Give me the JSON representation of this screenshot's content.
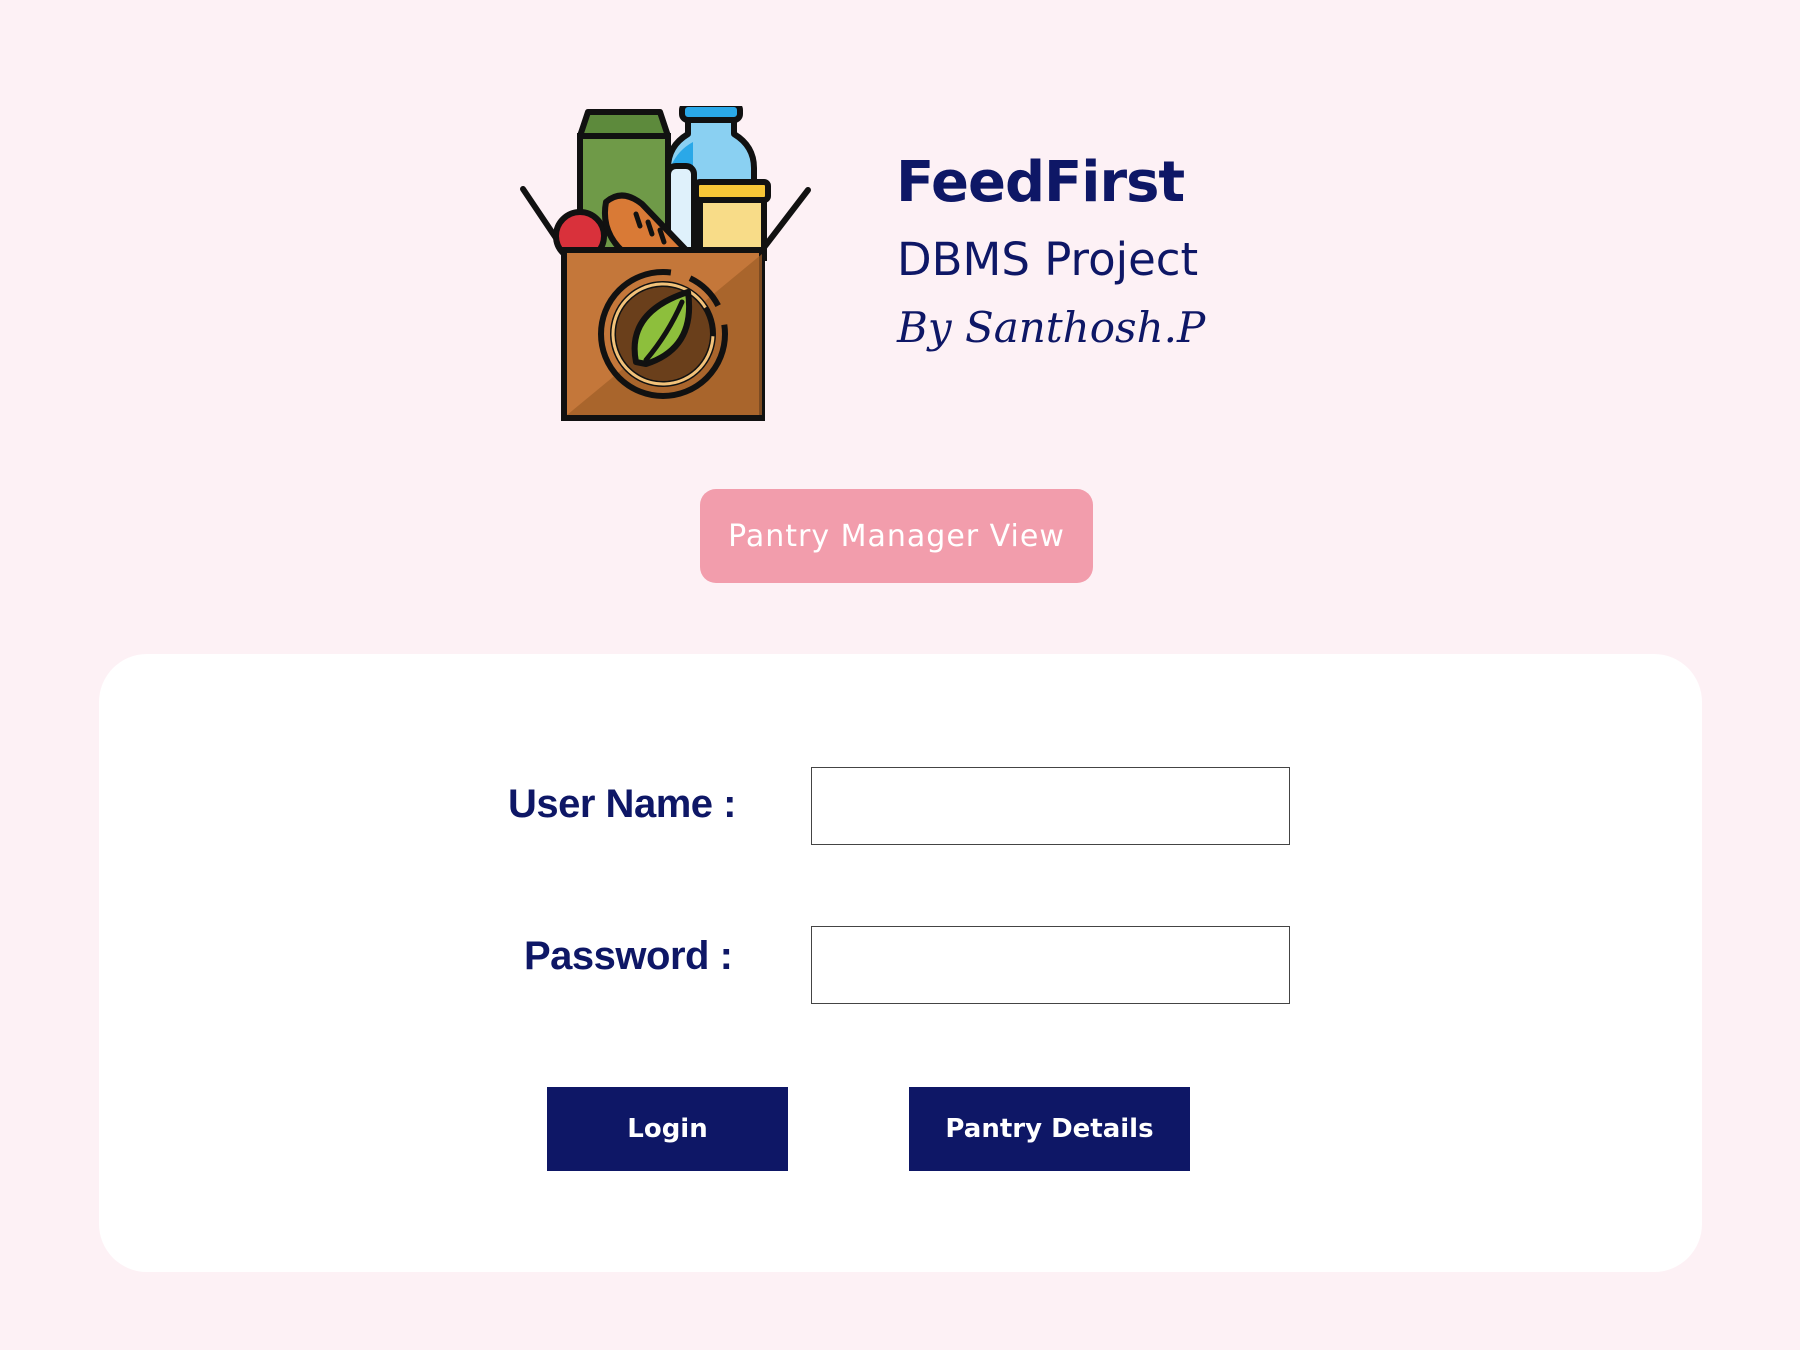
{
  "brand": {
    "title": "FeedFirst",
    "subtitle": "DBMS Project",
    "author": "By Santhosh.P",
    "logo_icon": "grocery-box-icon"
  },
  "view_button": {
    "label": "Pantry Manager View"
  },
  "login_form": {
    "username_label": "User Name :",
    "username_value": "",
    "password_label": "Password :",
    "password_value": "",
    "login_label": "Login",
    "pantry_details_label": "Pantry Details"
  },
  "colors": {
    "background": "#fdf1f5",
    "brand_navy": "#0e1766",
    "view_button_pink": "#f29dac",
    "card": "#ffffff"
  }
}
